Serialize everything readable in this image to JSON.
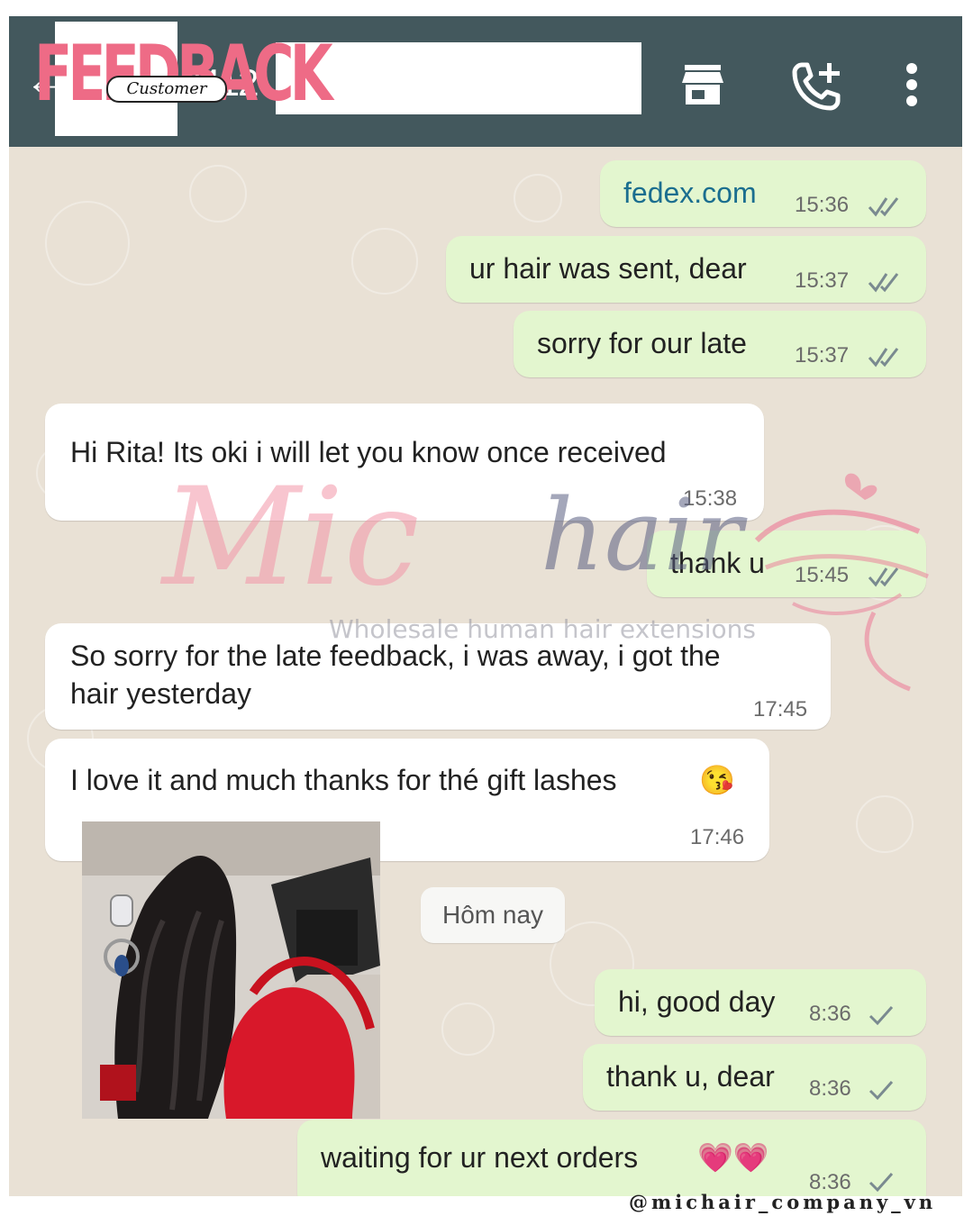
{
  "header": {
    "headline": "FEEDBACK",
    "badge": "Customer",
    "contact_digits": "2412",
    "icons": [
      "back-arrow-icon",
      "shop-icon",
      "add-call-icon",
      "more-vert-icon"
    ]
  },
  "messages": [
    {
      "dir": "out",
      "text": "fedex.com",
      "time": "15:36",
      "status": "read",
      "link": true
    },
    {
      "dir": "out",
      "text": "ur hair was sent, dear",
      "time": "15:37",
      "status": "read"
    },
    {
      "dir": "out",
      "text": "sorry for our late",
      "time": "15:37",
      "status": "read"
    },
    {
      "dir": "in",
      "text": "Hi Rita! Its oki i will let you know once received",
      "time": "15:38"
    },
    {
      "dir": "out",
      "text": "thank u",
      "time": "15:45",
      "status": "read"
    },
    {
      "dir": "in",
      "line1": "So sorry for the late feedback, i was away, i got the",
      "line2": "hair yesterday",
      "time": "17:45"
    },
    {
      "dir": "in",
      "text": "I love it and much thanks for thé gift lashes",
      "emoji": "😘",
      "time": "17:46"
    },
    {
      "dir": "out",
      "text": "hi, good day",
      "time": "8:36",
      "status": "sent"
    },
    {
      "dir": "out",
      "text": "thank u, dear",
      "time": "8:36",
      "status": "sent"
    },
    {
      "dir": "out",
      "text": "waiting for ur next orders",
      "emoji": "💗💗",
      "time": "8:36",
      "status": "sent"
    }
  ],
  "day_chip": "Hôm nay",
  "watermark": {
    "script": "Mic",
    "brand": "hair",
    "tagline": "Wholesale human hair extensions"
  },
  "handle": "@michair_company_vn",
  "colors": {
    "appbar": "#43585d",
    "outgoing_bubble": "#e3f6cf",
    "incoming_bubble": "#ffffff",
    "headline": "#ee6b86",
    "read_ticks": "#7a8a90"
  }
}
